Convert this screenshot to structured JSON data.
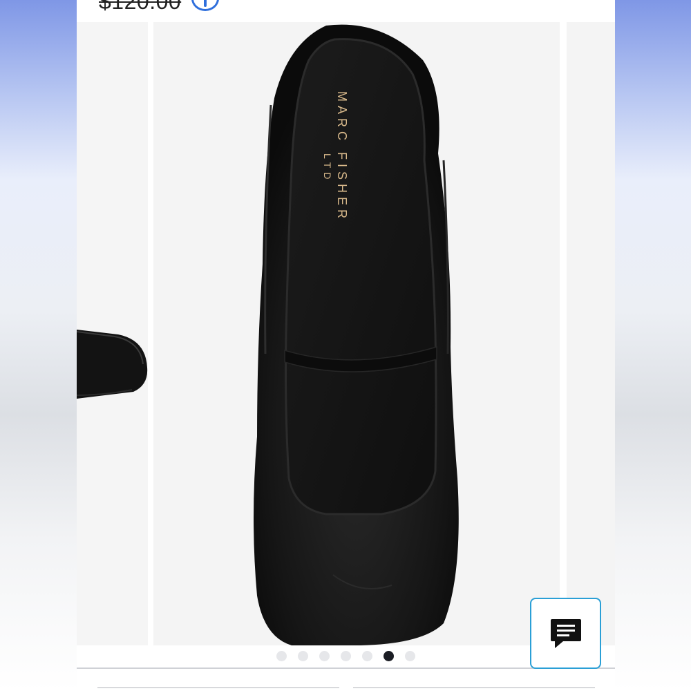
{
  "product": {
    "original_price": "$120.00",
    "brand_line1": "MARC FISHER",
    "brand_line2": "LTD"
  },
  "icons": {
    "info": "info-icon",
    "chat": "chat-icon"
  },
  "carousel": {
    "total_slides": 7,
    "active_index": 5
  },
  "colors": {
    "accent_blue": "#2f6fdc",
    "chat_border": "#2a9fd6",
    "dot_active": "#1b1d24",
    "dot_inactive": "#e6e7ea"
  }
}
